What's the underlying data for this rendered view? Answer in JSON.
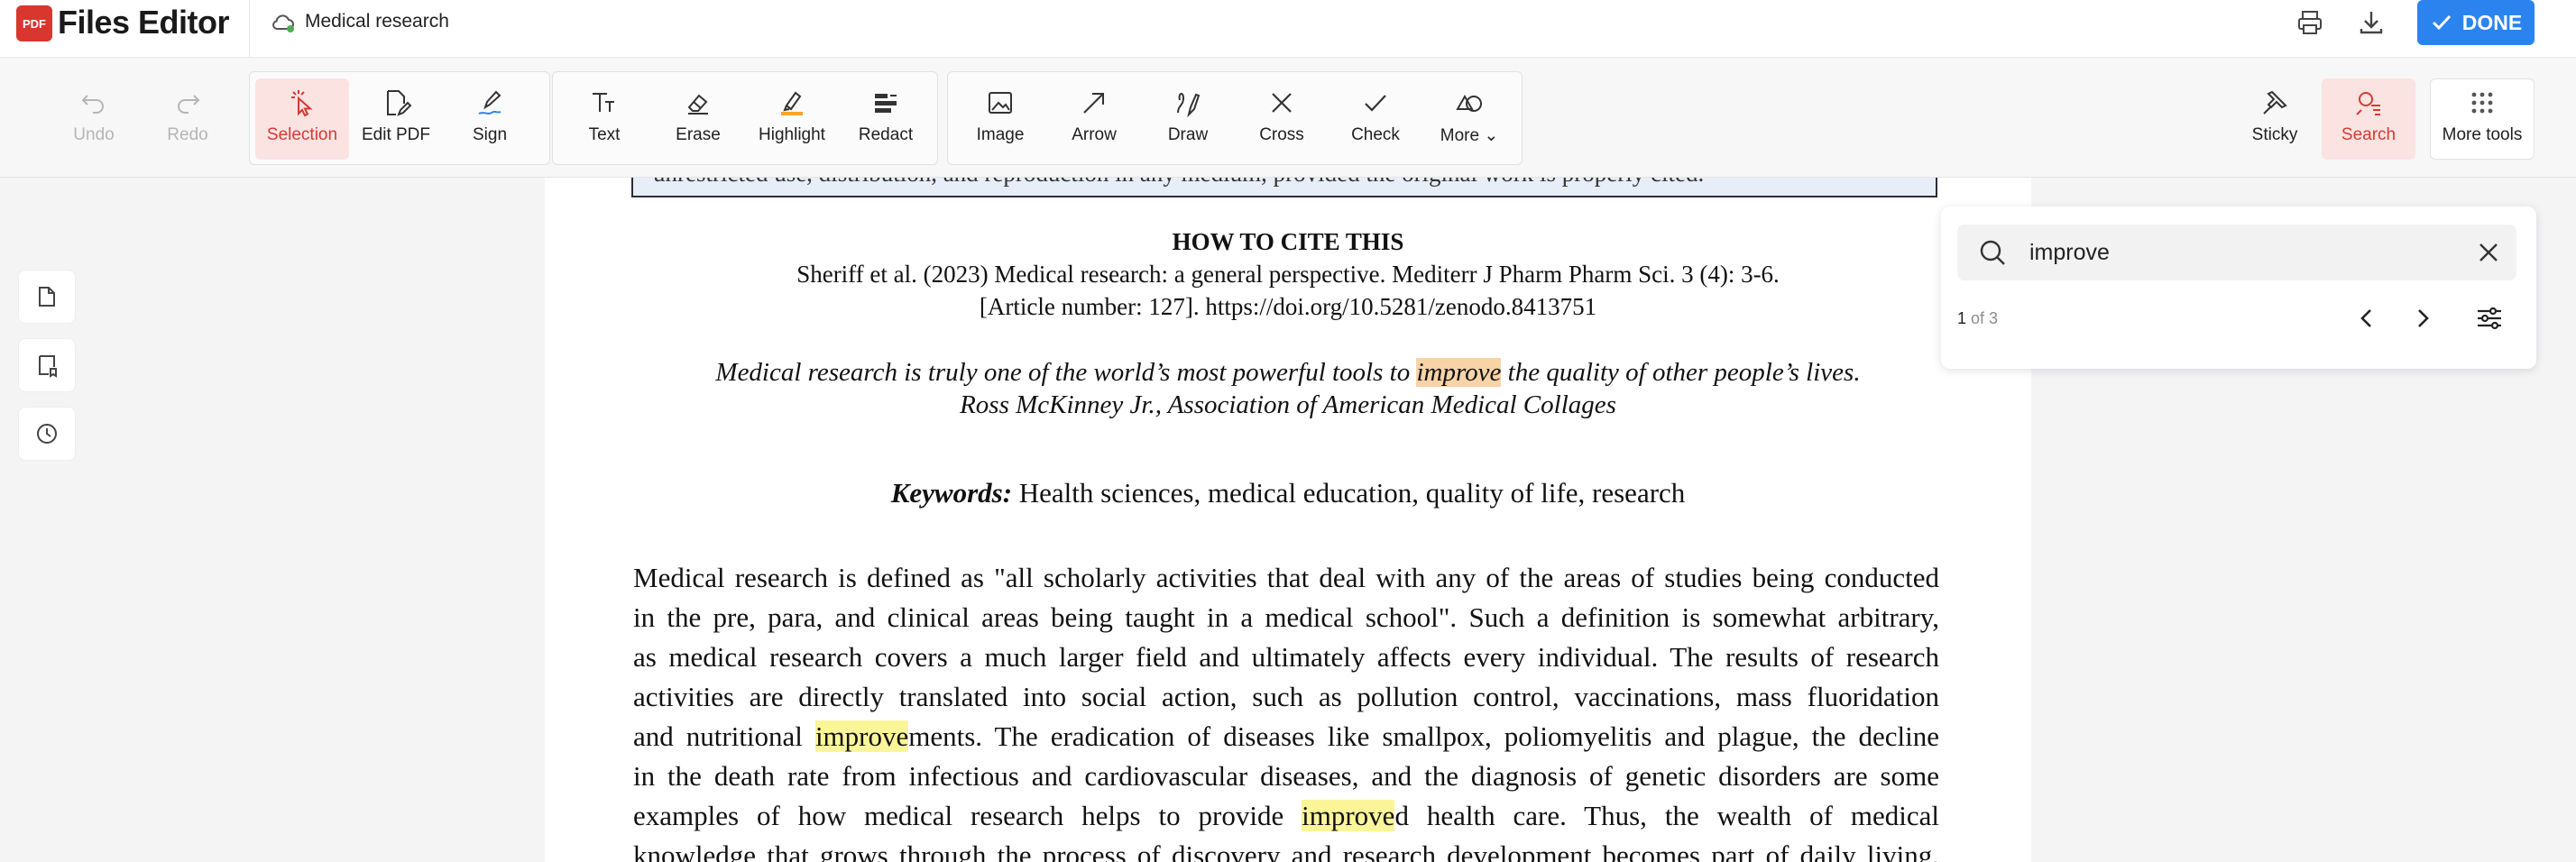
{
  "app": {
    "logo_badge": "PDF",
    "title": "Files Editor",
    "doc_name": "Medical research",
    "done_label": "DONE"
  },
  "toolbar": {
    "undo": "Undo",
    "redo": "Redo",
    "selection": "Selection",
    "edit_pdf": "Edit PDF",
    "sign": "Sign",
    "text": "Text",
    "erase": "Erase",
    "highlight": "Highlight",
    "redact": "Redact",
    "image": "Image",
    "arrow": "Arrow",
    "draw": "Draw",
    "cross": "Cross",
    "check": "Check",
    "more": "More",
    "sticky": "Sticky",
    "search": "Search",
    "more_tools": "More tools"
  },
  "colors": {
    "accent": "#2b83f0",
    "active_tool": "#d43a32",
    "current_match": "#f8d3a8",
    "match": "#fbf59a"
  },
  "search": {
    "query": "improve",
    "current": "1",
    "total_text": "of 3"
  },
  "document": {
    "license_line": "unrestricted use, distribution, and reproduction in any medium, provided the original work is properly cited.",
    "cite_title": "HOW TO CITE THIS",
    "cite_line1": "Sheriff et al. (2023) Medical research: a general perspective. Mediterr J Pharm Pharm Sci. 3 (4): 3-6.",
    "cite_line2": "[Article number: 127]. https://doi.org/10.5281/zenodo.8413751",
    "quote_pre": "Medical research is truly one of the world’s most powerful tools to ",
    "quote_match": "improve",
    "quote_post": " the quality of other people’s lives.",
    "quote_author": "Ross McKinney Jr., Association of American Medical Collages",
    "keywords_label": "Keywords:",
    "keywords_text": " Health sciences, medical education, quality of life, research",
    "line1": "Medical research is defined as \"all scholarly activities that deal with any of the areas of studies being conducted",
    "line2": "in the pre, para, and clinical areas being taught in a medical school\". Such a definition is somewhat arbitrary,",
    "line3": "as medical research covers a much larger field and ultimately affects every individual. The results of research",
    "line4": "activities are directly translated into social action, such as pollution control, vaccinations, mass fluoridation",
    "line5_pre": "and nutritional ",
    "line5_match": "improve",
    "line5_post": "ments. The eradication of diseases like smallpox, poliomyelitis and plague, the decline",
    "line6": "in the death rate from infectious and cardiovascular diseases, and the diagnosis of genetic disorders are some",
    "line7_pre": "examples of how medical research helps to provide ",
    "line7_match": "improve",
    "line7_post": "d health care. Thus, the wealth of medical",
    "line8": "knowledge that grows through the process of discovery and research development becomes part of daily living."
  }
}
